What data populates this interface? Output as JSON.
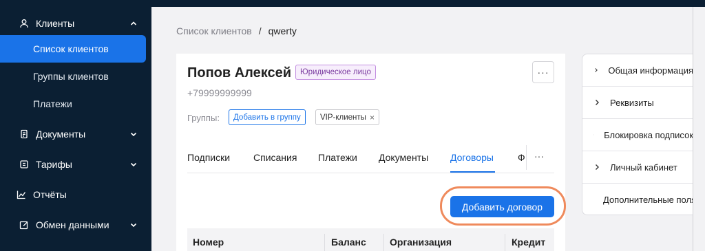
{
  "sidebar": {
    "clients": "Клиенты",
    "clients_list": "Список клиентов",
    "client_groups": "Группы клиентов",
    "payments": "Платежи",
    "documents": "Документы",
    "tariffs": "Тарифы",
    "reports": "Отчёты",
    "data_exchange": "Обмен данными"
  },
  "breadcrumb": {
    "parent": "Список клиентов",
    "separator": "/",
    "current": "qwerty"
  },
  "client": {
    "name": "Попов Алексей",
    "type_badge": "Юридическое лицо",
    "phone": "+79999999999",
    "more": "···",
    "groups_label": "Группы:",
    "add_group": "Добавить в группу",
    "group_tag": "VIP-клиенты",
    "group_tag_remove": "×"
  },
  "tabs": {
    "items": [
      "Подписки",
      "Списания",
      "Платежи",
      "Документы",
      "Договоры"
    ],
    "active": "Договоры",
    "cut_label": "Ф",
    "more": "···"
  },
  "contracts": {
    "add_button": "Добавить договор",
    "columns": [
      "Номер",
      "Баланс",
      "Организация",
      "Кредит"
    ]
  },
  "info_panel": {
    "rows": [
      "Общая информация",
      "Реквизиты",
      "Блокировка подписок",
      "Личный кабинет",
      "Дополнительные поля"
    ]
  },
  "colors": {
    "sidebar_bg": "#0b1f33",
    "accent": "#1a73e8",
    "highlight_ring": "#ef8a5c",
    "badge_purple": "#7a3b9f"
  }
}
